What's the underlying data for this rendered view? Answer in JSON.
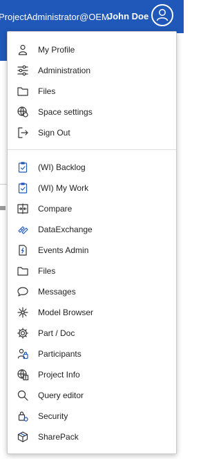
{
  "header": {
    "account": "ProjectAdministrator@OEM",
    "user_name": "John Doe"
  },
  "menu": {
    "account_items": [
      {
        "label": "My Profile",
        "icon": "person-icon"
      },
      {
        "label": "Administration",
        "icon": "sliders-icon"
      },
      {
        "label": "Files",
        "icon": "folder-icon"
      },
      {
        "label": "Space settings",
        "icon": "space-settings-icon"
      },
      {
        "label": "Sign Out",
        "icon": "sign-out-icon"
      }
    ],
    "app_items": [
      {
        "label": "(WI) Backlog",
        "icon": "clipboard-check-icon"
      },
      {
        "label": "(WI) My Work",
        "icon": "clipboard-check-icon"
      },
      {
        "label": "Compare",
        "icon": "compare-icon"
      },
      {
        "label": "DataExchange",
        "icon": "data-exchange-icon"
      },
      {
        "label": "Events Admin",
        "icon": "events-icon"
      },
      {
        "label": "Files",
        "icon": "folder-icon"
      },
      {
        "label": "Messages",
        "icon": "chat-bubble-icon"
      },
      {
        "label": "Model Browser",
        "icon": "model-browser-icon"
      },
      {
        "label": "Part / Doc",
        "icon": "gear-icon"
      },
      {
        "label": "Participants",
        "icon": "participants-icon"
      },
      {
        "label": "Project Info",
        "icon": "project-info-icon"
      },
      {
        "label": "Query editor",
        "icon": "search-icon"
      },
      {
        "label": "Security",
        "icon": "lock-icon"
      },
      {
        "label": "SharePack",
        "icon": "cube-icon"
      }
    ]
  },
  "colors": {
    "header_bg": "#1f58b8",
    "accent": "#1f58b8"
  }
}
